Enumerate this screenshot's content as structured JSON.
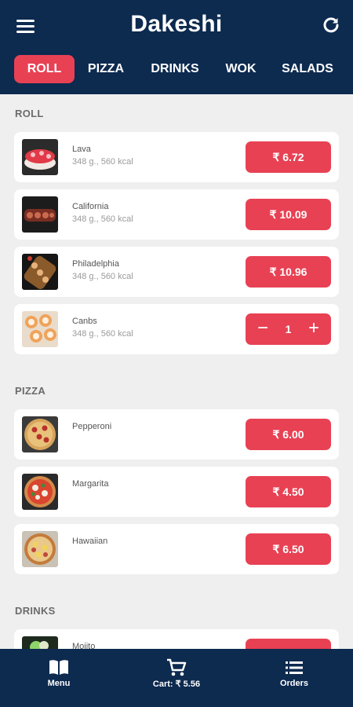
{
  "header": {
    "title": "Dakeshi",
    "menu_icon": "hamburger-menu-icon",
    "refresh_icon": "refresh-icon"
  },
  "tabs": [
    {
      "label": "ROLL",
      "active": true
    },
    {
      "label": "PIZZA",
      "active": false
    },
    {
      "label": "DRINKS",
      "active": false
    },
    {
      "label": "WOK",
      "active": false
    },
    {
      "label": "SALADS",
      "active": false
    }
  ],
  "sections": [
    {
      "title": "ROLL",
      "items": [
        {
          "name": "Lava",
          "meta": "348 g., 560 kcal",
          "price": "₹ 6.72"
        },
        {
          "name": "California",
          "meta": "348 g., 560 kcal",
          "price": "₹ 10.09"
        },
        {
          "name": "Philadelphia",
          "meta": "348 g., 560 kcal",
          "price": "₹ 10.96"
        },
        {
          "name": "Canbs",
          "meta": "348 g., 560 kcal",
          "quantity": "1",
          "minus": "−",
          "plus": "+"
        }
      ]
    },
    {
      "title": "PIZZA",
      "items": [
        {
          "name": "Pepperoni",
          "price": "₹ 6.00"
        },
        {
          "name": "Margarita",
          "price": "₹ 4.50"
        },
        {
          "name": "Hawaiian",
          "price": "₹ 6.50"
        }
      ]
    },
    {
      "title": "DRINKS",
      "items": [
        {
          "name": "Mojito"
        }
      ]
    }
  ],
  "bottom_nav": {
    "menu_label": "Menu",
    "cart_label": "Cart: ₹ 5.56",
    "orders_label": "Orders"
  },
  "colors": {
    "navy": "#0d2a4f",
    "accent": "#e84154",
    "background": "#efefef"
  }
}
